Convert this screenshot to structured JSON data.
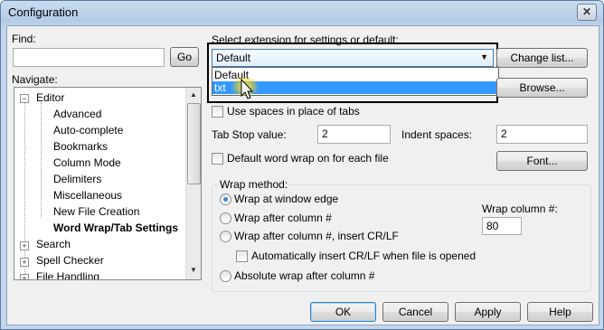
{
  "window": {
    "title": "Configuration",
    "close_glyph": "✕"
  },
  "find": {
    "label": "Find:",
    "value": "",
    "go_label": "Go"
  },
  "navigate": {
    "label": "Navigate:",
    "tree": [
      {
        "label": "Editor",
        "expander": "−"
      },
      {
        "label": "Advanced"
      },
      {
        "label": "Auto-complete"
      },
      {
        "label": "Bookmarks"
      },
      {
        "label": "Column Mode"
      },
      {
        "label": "Delimiters"
      },
      {
        "label": "Miscellaneous"
      },
      {
        "label": "New File Creation"
      },
      {
        "label": "Word Wrap/Tab Settings",
        "selected": true
      },
      {
        "label": "Search",
        "expander": "+"
      },
      {
        "label": "Spell Checker",
        "expander": "+"
      },
      {
        "label": "File Handling",
        "expander": "+"
      }
    ],
    "scroll_up": "▲",
    "scroll_down": "▼"
  },
  "extension": {
    "label": "Select extension for settings or default:",
    "selected": "Default",
    "dropdown_arrow": "▼",
    "options": [
      "Default",
      "txt"
    ],
    "highlighted": "txt",
    "change_list_label": "Change list...",
    "browse_label": "Browse..."
  },
  "use_spaces": {
    "label": "Use spaces in place of tabs",
    "checked": false
  },
  "tab_stop": {
    "label": "Tab Stop value:",
    "value": "2"
  },
  "indent": {
    "label": "Indent spaces:",
    "value": "2"
  },
  "default_wrap": {
    "label": "Default word wrap on for each file",
    "checked": false
  },
  "font_label": "Font...",
  "wrap_method": {
    "legend": "Wrap method:",
    "options": [
      {
        "label": "Wrap at window edge",
        "checked": true
      },
      {
        "label": "Wrap after column #",
        "checked": false
      },
      {
        "label": "Wrap after column #, insert CR/LF",
        "checked": false
      },
      {
        "label": "Absolute wrap after column #",
        "checked": false
      }
    ],
    "auto_crlf_label": "Automatically insert CR/LF when file is opened",
    "wrap_column_label": "Wrap column #:",
    "wrap_column_value": "80"
  },
  "footer": {
    "ok": "OK",
    "cancel": "Cancel",
    "apply": "Apply",
    "help": "Help"
  },
  "colors": {
    "accent_highlight": "#3399ff",
    "focus_ring": "#000000",
    "cursor_glow": "#f5d000"
  },
  "icons": {
    "cursor": "arrow-pointer-icon"
  }
}
